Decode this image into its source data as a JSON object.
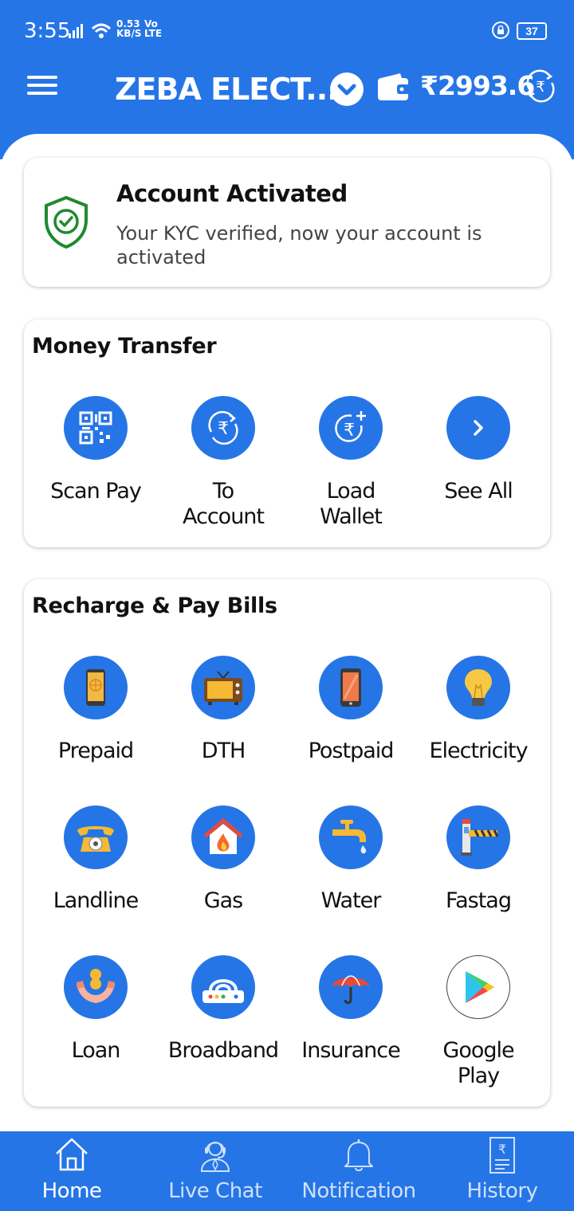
{
  "status_bar": {
    "time": "3:55",
    "speed_value": "0.53",
    "speed_unit": "KB/S",
    "network_top": "Vo",
    "network_bottom": "LTE",
    "battery": "37"
  },
  "app_bar": {
    "title": "ZEBA ELECT...",
    "balance": "₹2993.6"
  },
  "kyc_card": {
    "title": "Account Activated",
    "description": "Your KYC verified, now your account is activated"
  },
  "money_transfer": {
    "title": "Money Transfer",
    "items": [
      {
        "label_1": "Scan Pay",
        "label_2": "",
        "icon": "qr-code-icon"
      },
      {
        "label_1": "To",
        "label_2": "Account",
        "icon": "rupee-transfer-icon"
      },
      {
        "label_1": "Load",
        "label_2": "Wallet",
        "icon": "rupee-add-icon"
      },
      {
        "label_1": "See All",
        "label_2": "",
        "icon": "chevron-right-icon"
      }
    ]
  },
  "recharge": {
    "title": "Recharge & Pay Bills",
    "items": [
      {
        "label_1": "Prepaid",
        "label_2": "",
        "icon": "mobile-phone-icon"
      },
      {
        "label_1": "DTH",
        "label_2": "",
        "icon": "tv-icon"
      },
      {
        "label_1": "Postpaid",
        "label_2": "",
        "icon": "smartphone-icon"
      },
      {
        "label_1": "Electricity",
        "label_2": "",
        "icon": "bulb-icon"
      },
      {
        "label_1": "Landline",
        "label_2": "",
        "icon": "telephone-icon"
      },
      {
        "label_1": "Gas",
        "label_2": "",
        "icon": "gas-house-icon"
      },
      {
        "label_1": "Water",
        "label_2": "",
        "icon": "water-tap-icon"
      },
      {
        "label_1": "Fastag",
        "label_2": "",
        "icon": "toll-barrier-icon"
      },
      {
        "label_1": "Loan",
        "label_2": "",
        "icon": "loan-hands-icon"
      },
      {
        "label_1": "Broadband",
        "label_2": "",
        "icon": "router-icon"
      },
      {
        "label_1": "Insurance",
        "label_2": "",
        "icon": "umbrella-icon"
      },
      {
        "label_1": "Google",
        "label_2": "Play",
        "icon": "google-play-icon"
      }
    ]
  },
  "bottom_nav": {
    "items": [
      {
        "label": "Home",
        "active": true
      },
      {
        "label": "Live Chat",
        "active": false
      },
      {
        "label": "Notification",
        "active": false
      },
      {
        "label": "History",
        "active": false
      }
    ]
  },
  "colors": {
    "primary": "#2575e6",
    "success": "#1e8a2e"
  }
}
